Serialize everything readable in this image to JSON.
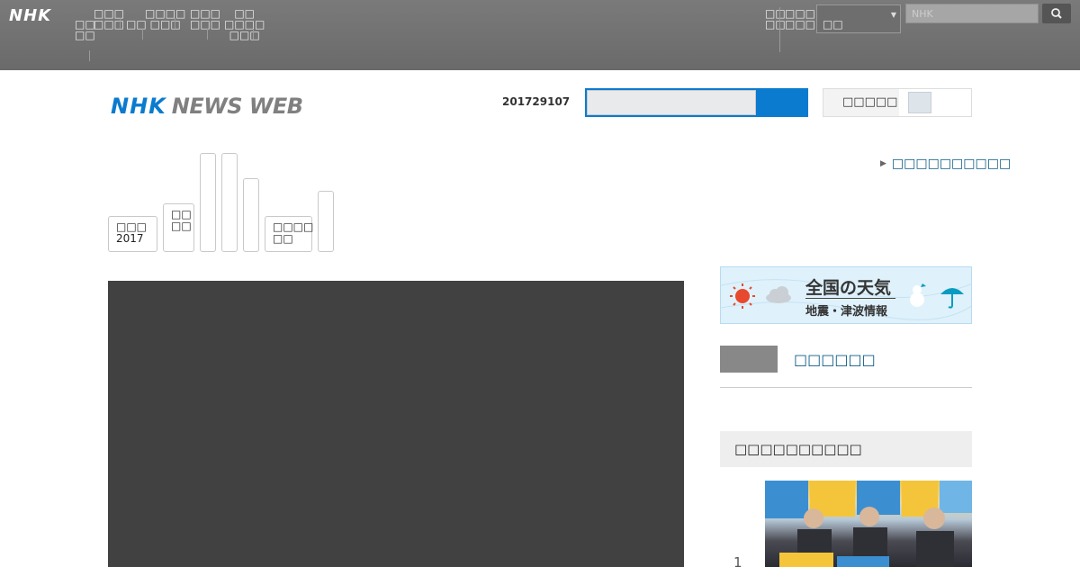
{
  "global_bar": {
    "logo": "NHK",
    "nav": [
      "□□\n□□",
      "□□□\n□□□",
      "□□",
      "□□□□\n□□□",
      "□□□\n□□□",
      "□□\n□□□□\n□□□"
    ],
    "right_nav": [
      "□□\n□□",
      "□□□\n□□□"
    ],
    "search_scope": "□□",
    "search_placeholder": "NHK"
  },
  "header": {
    "logo_nhk": "NHK",
    "logo_news_web": "NEWS WEB",
    "date": "201729107",
    "readout_label": "□□□□□"
  },
  "tabs": [
    {
      "label": "□□□\n2017"
    },
    {
      "label": "□□\n□□"
    },
    {
      "label": ""
    },
    {
      "label": ""
    },
    {
      "label": ""
    },
    {
      "label": "□□□□\n□□"
    },
    {
      "label": ""
    }
  ],
  "link_all": "□□□□□□□□□□",
  "sidebar": {
    "weather_title": "全国の天気",
    "weather_sub": "地震・津波情報",
    "live_label": "□□□□□□",
    "ranking_title": "□□□□□□□□□□",
    "ranking_first_number": "1"
  },
  "colors": {
    "brand_blue": "#0a7bcf",
    "global_bar": "#707070",
    "link": "#0b5b85"
  }
}
